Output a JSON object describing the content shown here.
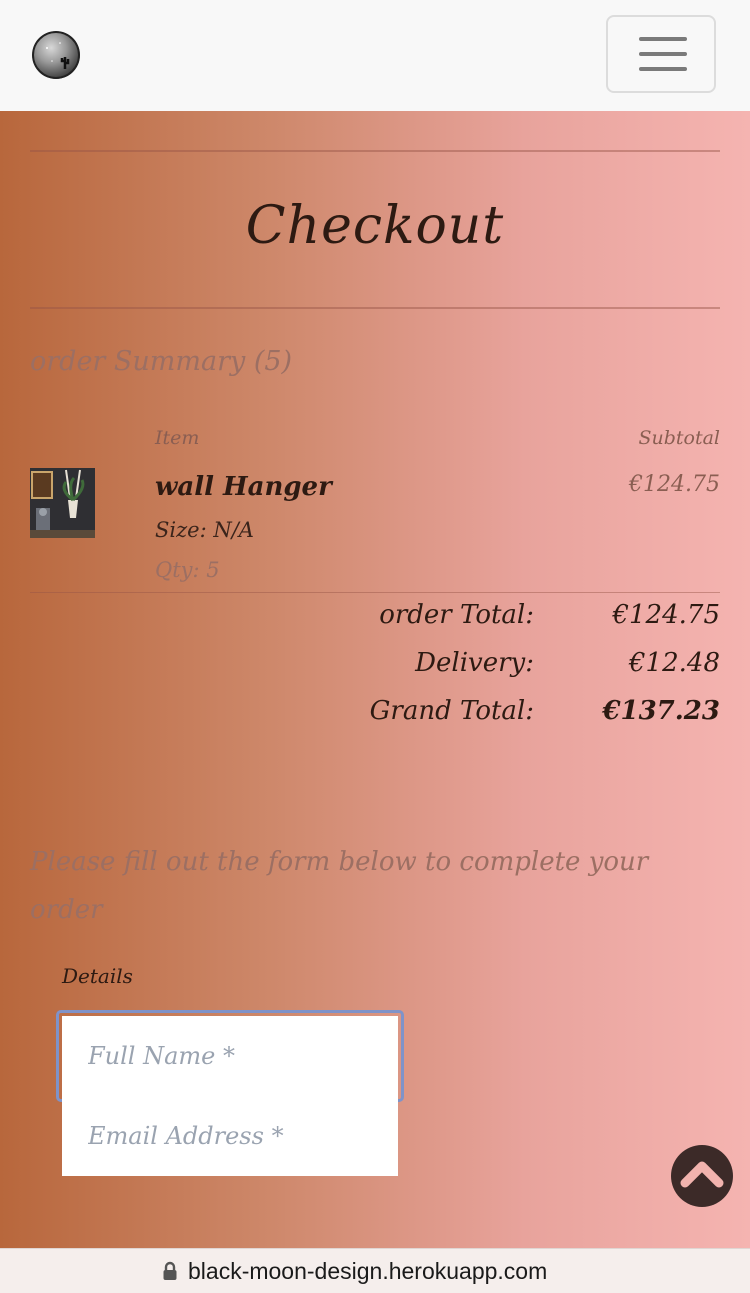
{
  "header": {
    "logo_icon": "moon-cactus-logo-icon",
    "menu_icon": "hamburger-menu-icon"
  },
  "checkout": {
    "title": "Checkout"
  },
  "order_summary": {
    "heading": "order Summary (5)",
    "columns": {
      "item": "Item",
      "subtotal": "Subtotal"
    },
    "items": [
      {
        "name": "wall Hanger",
        "size": "Size: N/A",
        "qty": "Qty: 5",
        "subtotal": "€124.75"
      }
    ],
    "totals": {
      "order_total_label": "order Total:",
      "order_total_value": "€124.75",
      "delivery_label": "Delivery:",
      "delivery_value": "€12.48",
      "grand_total_label": "Grand Total:",
      "grand_total_value": "€137.23"
    }
  },
  "form": {
    "prompt": "Please fill out the form below to complete your order",
    "fieldset_legend": "Details",
    "full_name_placeholder": "Full Name *",
    "email_placeholder": "Email Address *"
  },
  "back_to_top_icon": "chevron-up-icon",
  "browser": {
    "url": "black-moon-design.herokuapp.com",
    "lock_icon": "lock-icon"
  },
  "colors": {
    "gradient_start": "#b8673c",
    "gradient_end": "#f5b4b1",
    "text_dark": "#2d1a12",
    "text_muted": "#9c6f63",
    "focus_ring": "#7f93c9"
  }
}
